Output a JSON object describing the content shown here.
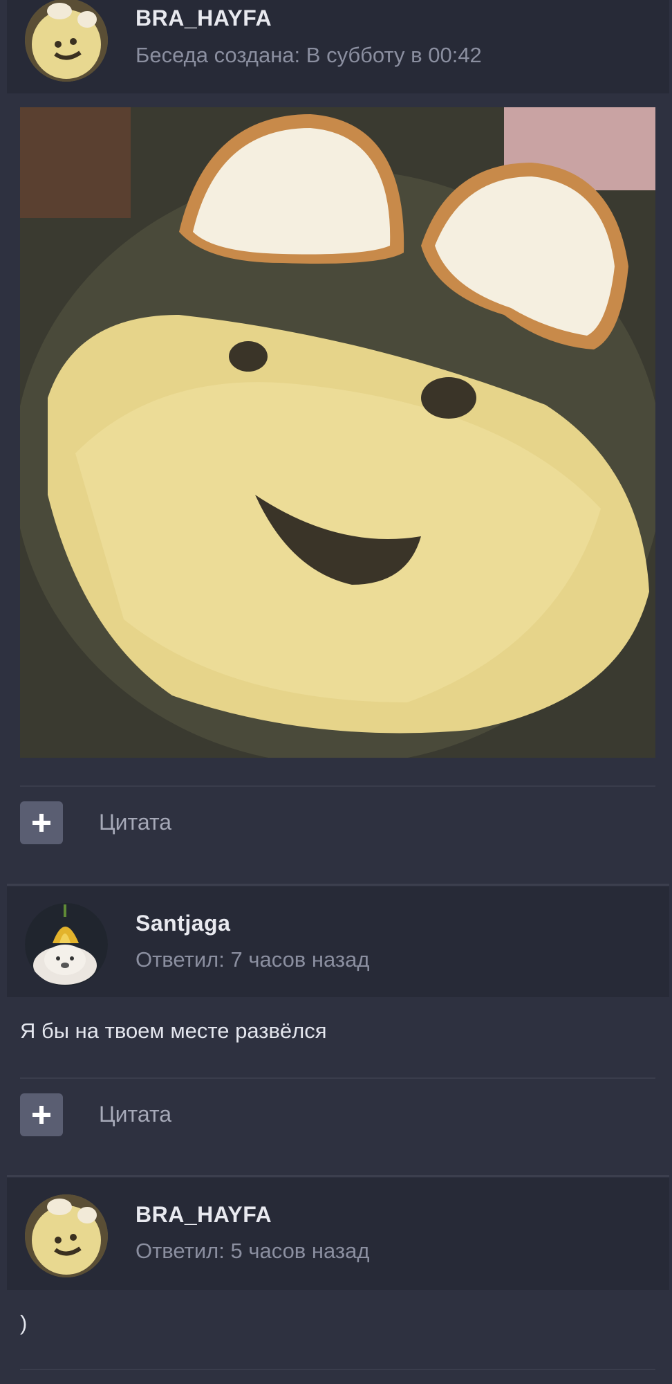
{
  "posts": [
    {
      "author": "BRA_HAYFA",
      "meta": "Беседа создана: В субботу в 00:42",
      "avatar_icon": "rice-smiley-avatar",
      "image": "rice-smiley-face-photo",
      "quote_label": "Цитата"
    },
    {
      "author": "Santjaga",
      "meta": "Ответил: 7 часов назад",
      "avatar_icon": "dog-with-flower-avatar",
      "text": "Я бы на твоем месте развёлся",
      "quote_label": "Цитата"
    },
    {
      "author": "BRA_HAYFA",
      "meta": "Ответил: 5 часов назад",
      "avatar_icon": "rice-smiley-avatar",
      "text": ")"
    }
  ],
  "colors": {
    "background": "#2e3140",
    "header": "#272a37",
    "muted": "#8b8fa0",
    "button": "#5a5e72"
  }
}
